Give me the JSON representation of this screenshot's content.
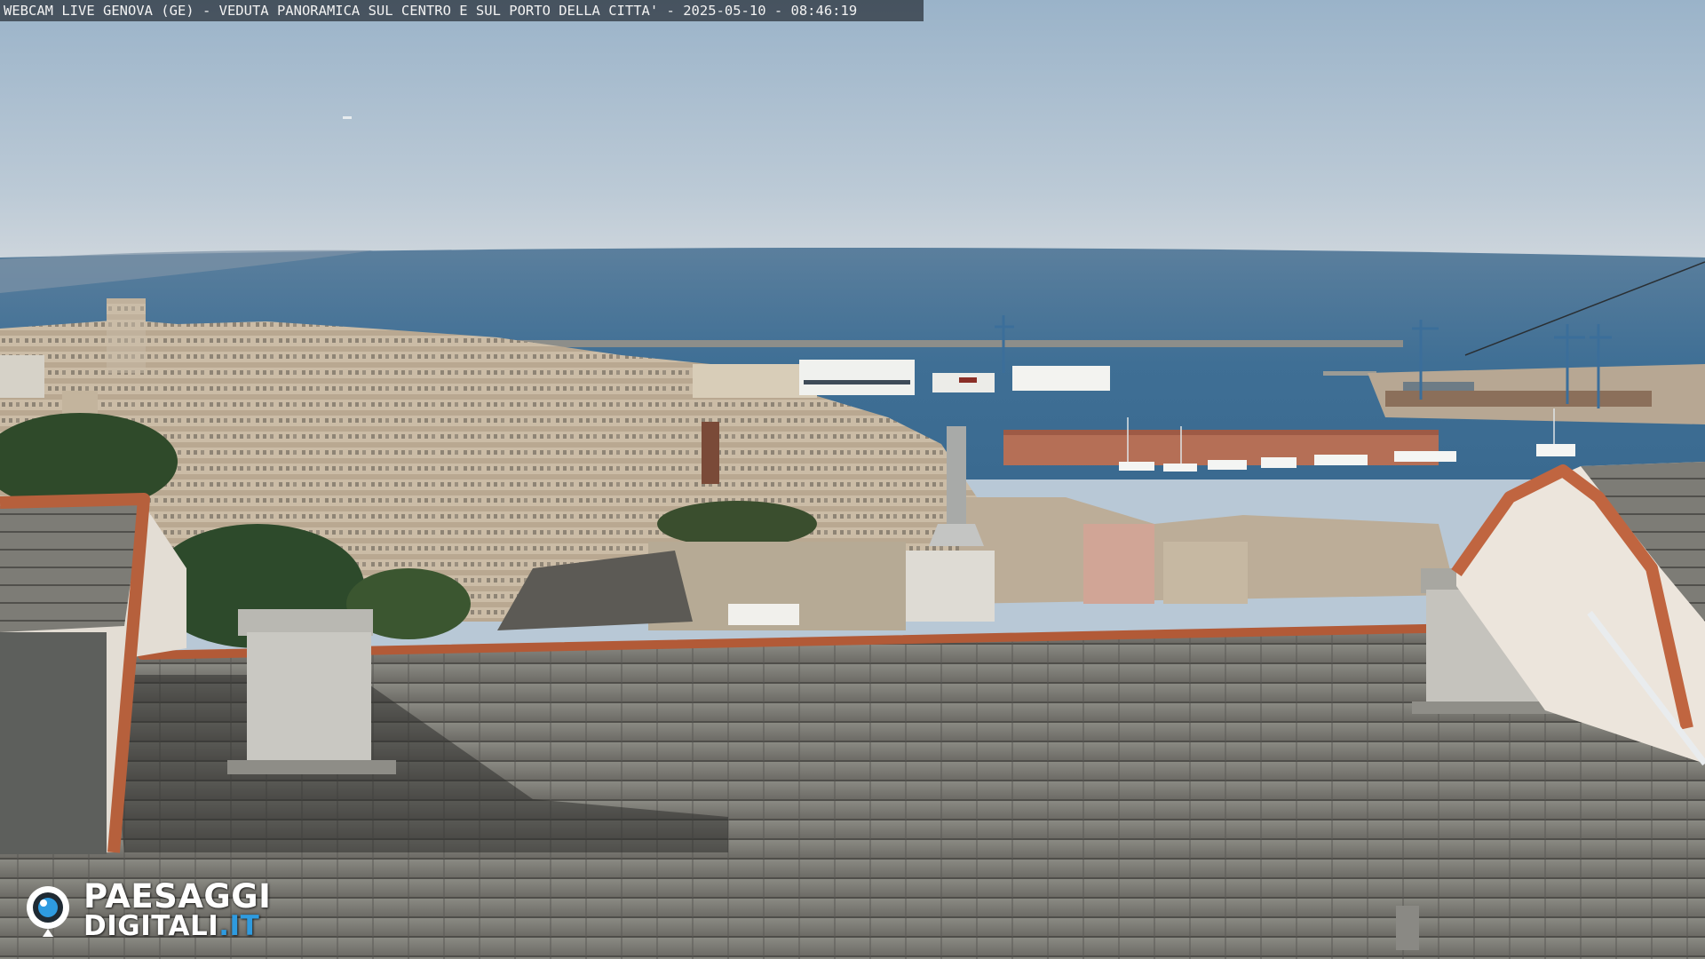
{
  "overlay": {
    "caption": "WEBCAM LIVE GENOVA (GE) - VEDUTA PANORAMICA SUL CENTRO E SUL PORTO DELLA CITTA' - 2025-05-10 - 08:46:19"
  },
  "watermark": {
    "line1": "PAESAGGI",
    "line2": "DIGITALI",
    "suffix": ".IT",
    "accent_color": "#2e9be0"
  },
  "colors": {
    "sky_top": "#9fb7cc",
    "sky_horizon": "#c9d3db",
    "sea": "#3d6f97",
    "roof_slate": "#6e6d68",
    "terracotta": "#c0643e",
    "city": "#c9b9a3"
  }
}
